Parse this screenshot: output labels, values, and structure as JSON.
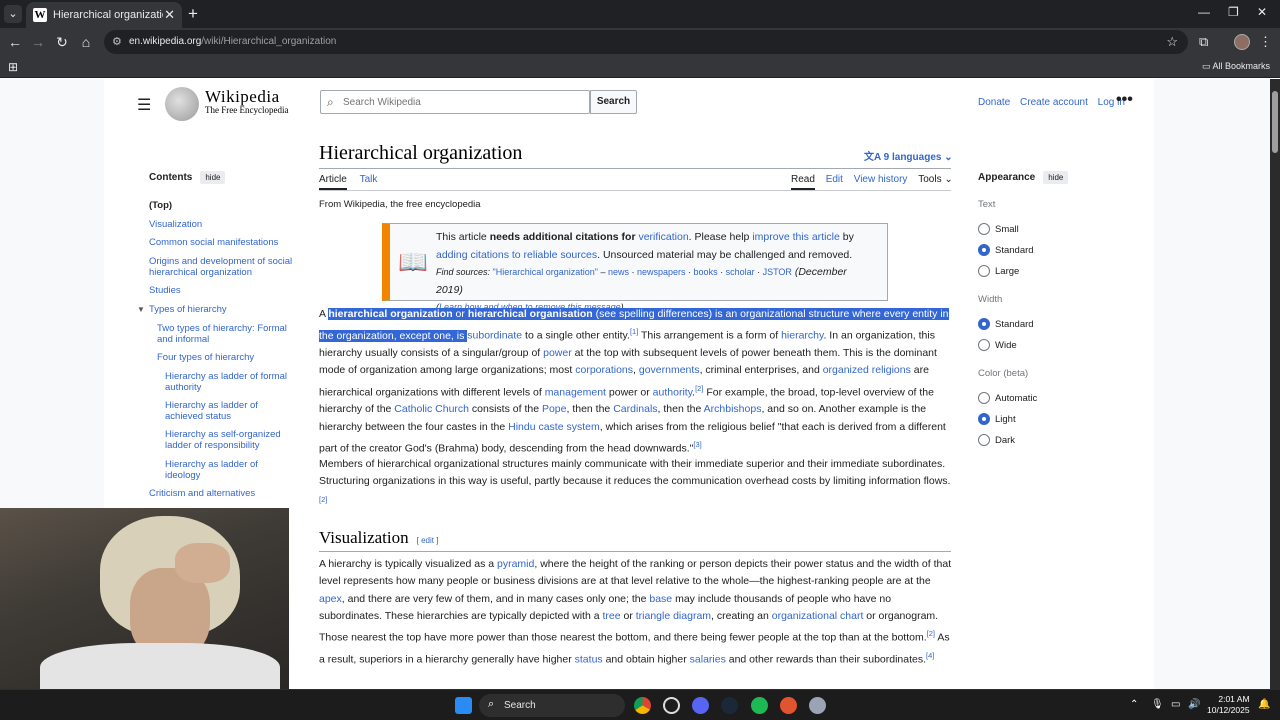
{
  "browser": {
    "tab_title": "Hierarchical organization - Wiki",
    "url_domain": "en.wikipedia.org",
    "url_path": "/wiki/Hierarchical_organization",
    "all_bookmarks": "All Bookmarks"
  },
  "wiki": {
    "wordmark": "Wikipedia",
    "tagline": "The Free Encyclopedia",
    "search_placeholder": "Search Wikipedia",
    "search_button": "Search",
    "donate": "Donate",
    "create_account": "Create account",
    "login": "Log in"
  },
  "toc": {
    "heading": "Contents",
    "hide": "hide",
    "items": [
      "(Top)",
      "Visualization",
      "Common social manifestations",
      "Origins and development of social hierarchical organization",
      "Studies",
      "Types of hierarchy",
      "Two types of hierarchy: Formal and informal",
      "Four types of hierarchy",
      "Hierarchy as ladder of formal authority",
      "Hierarchy as ladder of achieved status",
      "Hierarchy as self-organized ladder of responsibility",
      "Hierarchy as ladder of ideology",
      "Criticism and alternatives"
    ]
  },
  "article": {
    "title": "Hierarchical organization",
    "languages": "9 languages",
    "tab_article": "Article",
    "tab_talk": "Talk",
    "tab_read": "Read",
    "tab_edit": "Edit",
    "tab_history": "View history",
    "tab_tools": "Tools",
    "from": "From Wikipedia, the free encyclopedia",
    "ambox": {
      "t1": "This article ",
      "t2": "needs additional citations for ",
      "t3": "verification",
      "t4": ". Please help ",
      "t5": "improve this article",
      "t6": " by",
      "t7": "adding citations to reliable sources",
      "t8": ". Unsourced material may be challenged and removed.",
      "find": "Find sources: ",
      "q": "\"Hierarchical organization\"",
      "dash": " – ",
      "news": "news",
      "newspapers": "newspapers",
      "books": "books",
      "scholar": "scholar",
      "jstor": "JSTOR",
      "date": " (December 2019)",
      "learn": "Learn how and when to remove this message"
    },
    "p1": {
      "a": "A ",
      "b1": "hierarchical organization",
      "b2": " or ",
      "b3": "hierarchical organisation",
      "b4": " (see spelling differences) is an organizational structure where every entity in the organization, except one, is ",
      "link_subordinate": "subordinate",
      "c": " to a single other entity.",
      "ref1": "[1]",
      "d": " This arrangement is a form of ",
      "link_hierarchy": "hierarchy",
      "e": ". In an organization, this hierarchy usually consists of a singular/group of ",
      "link_power": "power",
      "f": " at the top with subsequent levels of power beneath them. This is the dominant mode of organization among large organizations; most ",
      "link_corporations": "corporations",
      "g": ", ",
      "link_governments": "governments",
      "h": ", criminal enterprises, and ",
      "link_religions": "organized religions",
      "i": " are hierarchical organizations with different levels of ",
      "link_management": "management",
      "j": " power or ",
      "link_authority": "authority",
      "k": ".",
      "ref2": "[2]",
      "l": " For example, the broad, top-level overview of the hierarchy of the ",
      "link_church": "Catholic Church",
      "m": " consists of the ",
      "link_pope": "Pope",
      "n": ", then the ",
      "link_cardinals": "Cardinals",
      "o": ", then the ",
      "link_archbishops": "Archbishops",
      "p": ", and so on. Another example is the hierarchy between the four castes in the ",
      "link_caste": "Hindu caste system",
      "q": ", which arises from the religious belief \"that each is derived from a different part of the creator God's (Brahma) body, descending from the head downwards.\"",
      "ref3": "[3]"
    },
    "p2": {
      "text": "Members of hierarchical organizational structures mainly communicate with their immediate superior and their immediate subordinates. Structuring organizations in this way is useful, partly because it reduces the communication overhead costs by limiting information flows.",
      "ref": "[2]"
    },
    "section_visualization": "Visualization",
    "edit": "edit",
    "p3": {
      "a": "A hierarchy is typically visualized as a ",
      "link_pyramid": "pyramid",
      "b": ", where the height of the ranking or person depicts their power status and the width of that level represents how many people or business divisions are at that level relative to the whole—the highest-ranking people are at the ",
      "link_apex": "apex",
      "c": ", and there are very few of them, and in many cases only one; the ",
      "link_base": "base",
      "d": " may include thousands of people who have no subordinates. These hierarchies are typically depicted with a ",
      "link_tree": "tree",
      "e": " or ",
      "link_triangle": "triangle diagram",
      "f": ", creating an ",
      "link_orgchart": "organizational chart",
      "g": " or organogram. Those nearest the top have more power than those nearest the bottom, and there being fewer people at the top than at the bottom.",
      "ref2": "[2]",
      "h": " As a result, superiors in a hierarchy generally have higher ",
      "link_status": "status",
      "i": " and obtain higher ",
      "link_salaries": "salaries",
      "j": " and other rewards than their subordinates.",
      "ref4": "[4]"
    }
  },
  "appearance": {
    "heading": "Appearance",
    "hide": "hide",
    "text_label": "Text",
    "text_small": "Small",
    "text_standard": "Standard",
    "text_large": "Large",
    "width_label": "Width",
    "width_standard": "Standard",
    "width_wide": "Wide",
    "color_label": "Color (beta)",
    "color_auto": "Automatic",
    "color_light": "Light",
    "color_dark": "Dark"
  },
  "taskbar": {
    "search": "Search",
    "time": "2:01 AM",
    "date": "10/12/2025"
  }
}
